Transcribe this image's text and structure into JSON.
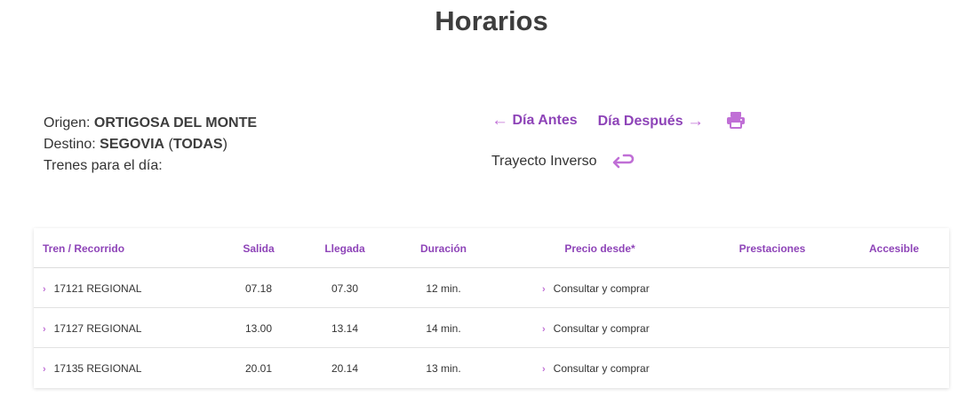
{
  "page": {
    "title": "Horarios"
  },
  "info": {
    "origin_label": "Origen:",
    "origin_value": "ORTIGOSA DEL MONTE",
    "dest_label": "Destino:",
    "dest_value": "SEGOVIA",
    "dest_paren_open": "(",
    "dest_sub": "TODAS",
    "dest_paren_close": ")",
    "trains_label": "Trenes para el día:"
  },
  "nav": {
    "prev_arrow": "←",
    "prev_label": "Día Antes",
    "next_label": "Día Después",
    "next_arrow": "→",
    "inverse_label": "Trayecto Inverso"
  },
  "table": {
    "headers": {
      "train": "Tren / Recorrido",
      "departure": "Salida",
      "arrival": "Llegada",
      "duration": "Duración",
      "price": "Precio desde*",
      "services": "Prestaciones",
      "accessible": "Accesible"
    },
    "chevron": "›",
    "rows": [
      {
        "train": "17121 REGIONAL",
        "departure": "07.18",
        "arrival": "07.30",
        "duration": "12 min.",
        "price": "Consultar y comprar"
      },
      {
        "train": "17127 REGIONAL",
        "departure": "13.00",
        "arrival": "13.14",
        "duration": "14 min.",
        "price": "Consultar y comprar"
      },
      {
        "train": "17135 REGIONAL",
        "departure": "20.01",
        "arrival": "20.14",
        "duration": "13 min.",
        "price": "Consultar y comprar"
      }
    ]
  },
  "colors": {
    "accent": "#8e44b8",
    "accent_light": "#c06fd6",
    "text": "#333333"
  },
  "icons": {
    "print": "printer-icon",
    "inverse": "return-arrow-icon"
  }
}
